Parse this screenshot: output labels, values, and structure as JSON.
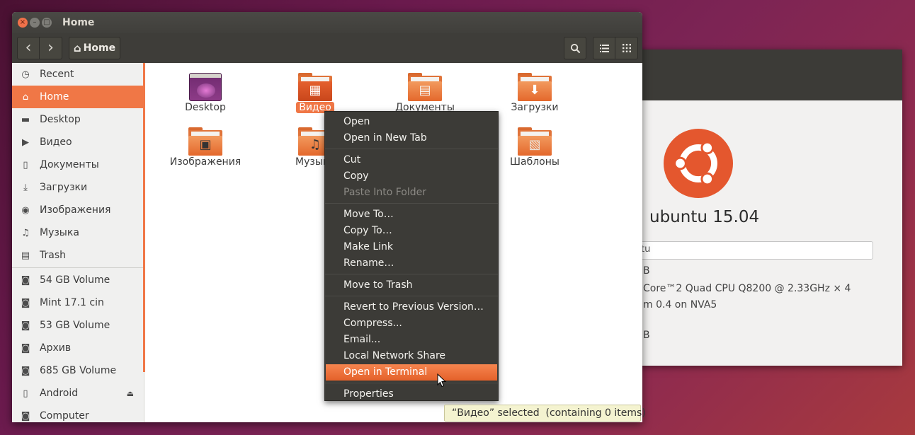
{
  "window": {
    "title": "Home",
    "close_glyph": "×",
    "min_glyph": "–",
    "max_glyph": "□"
  },
  "toolbar": {
    "back_icon": "‹",
    "forward_icon": "›",
    "path_label": "Home",
    "home_icon": "⌂",
    "search_icon": "search-icon",
    "list_icon": "≣",
    "grid_icon": "⠿"
  },
  "sidebar": {
    "items": [
      {
        "label": "Recent",
        "icon": "◷"
      },
      {
        "label": "Home",
        "icon": "⌂"
      },
      {
        "label": "Desktop",
        "icon": "▬"
      },
      {
        "label": "Видео",
        "icon": "▶"
      },
      {
        "label": "Документы",
        "icon": "▯"
      },
      {
        "label": "Загрузки",
        "icon": "⤓"
      },
      {
        "label": "Изображения",
        "icon": "◉"
      },
      {
        "label": "Музыка",
        "icon": "♫"
      },
      {
        "label": "Trash",
        "icon": "▤"
      }
    ],
    "devices": [
      {
        "label": "54 GB Volume",
        "icon": "◙"
      },
      {
        "label": "Mint 17.1 cin",
        "icon": "◙"
      },
      {
        "label": "53 GB Volume",
        "icon": "◙"
      },
      {
        "label": "Архив",
        "icon": "◙"
      },
      {
        "label": "685 GB Volume",
        "icon": "◙"
      },
      {
        "label": "Android",
        "icon": "▯",
        "eject": "⏏"
      },
      {
        "label": "Computer",
        "icon": "◙"
      }
    ]
  },
  "files": [
    {
      "label": "Desktop"
    },
    {
      "label": "Видео"
    },
    {
      "label": "Документы"
    },
    {
      "label": "Загрузки"
    },
    {
      "label": "Изображения"
    },
    {
      "label": "Музыка"
    },
    {
      "label": "Шаблоны"
    }
  ],
  "context_menu": {
    "items": [
      "Open",
      "Open in New Tab",
      "Cut",
      "Copy",
      "Paste Into Folder",
      "Move To…",
      "Copy To…",
      "Make Link",
      "Rename…",
      "Move to Trash",
      "Revert to Previous Version…",
      "Compress...",
      "Email...",
      "Local Network Share",
      "Open in Terminal",
      "Properties"
    ]
  },
  "status": {
    "text": "“Видео” selected  (containing 0 items)"
  },
  "about": {
    "title": "ubuntu 15.04",
    "field_value": "tu",
    "row1": "B",
    "row2": "Core™2 Quad CPU Q8200 @ 2.33GHz × 4",
    "row3": "m 0.4 on NVA5",
    "row4": "B"
  },
  "colors": {
    "accent": "#f07746",
    "dark": "#3c3b37"
  }
}
